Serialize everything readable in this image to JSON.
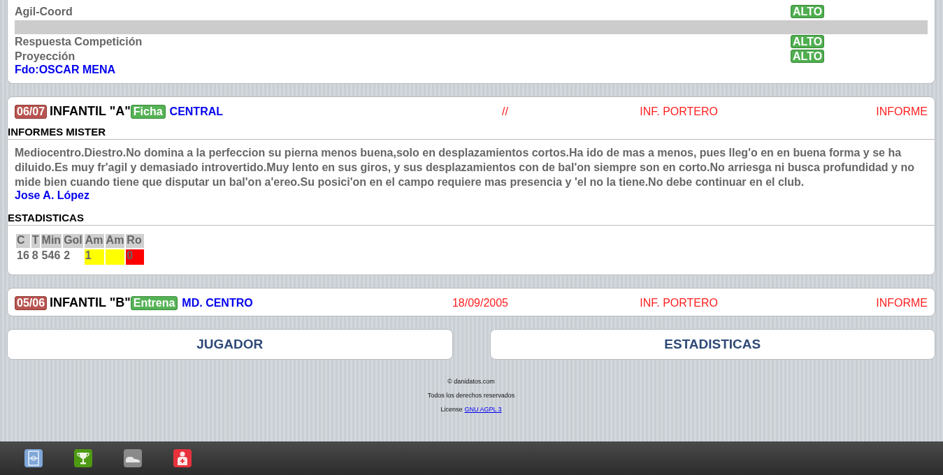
{
  "evaluation": {
    "rows": [
      {
        "kind": "rating",
        "label": "Agil-Coord",
        "value": "ALTO"
      },
      {
        "kind": "separator"
      },
      {
        "kind": "rating",
        "label": "Respuesta Competición",
        "value": "ALTO"
      },
      {
        "kind": "rating",
        "label": "Proyección",
        "value": "ALTO"
      }
    ],
    "signature": "Fdo:OSCAR MENA"
  },
  "seasons": [
    {
      "season": "06/07",
      "team": "INFANTIL \"A\"",
      "tag": "Ficha",
      "position": "CENTRAL",
      "date": "//",
      "portero": "INF. PORTERO",
      "informe": "INFORME",
      "report": {
        "heading": "INFORMES MISTER",
        "text": "Mediocentro.Diestro.No domina a la perfeccion su pierna menos buena,solo en desplazamientos cortos.Ha ido de mas a menos, pues lleg'o en en buena forma y se ha diluido.Es muy fr'agil y demasiado introvertido.Muy lento en sus giros, y sus desplazamientos con de bal'on siempre son en corto.No arriesga ni busca profundidad y no mide bien cuando tiene que disputar un bal'on a'ereo.Su posici'on en el campo requiere mas presencia y 'el no la tiene.No debe continuar en el club.",
        "author": "Jose A. López"
      },
      "stats": {
        "heading": "ESTADISTICAS",
        "columns": [
          {
            "header": "C",
            "value": "16"
          },
          {
            "header": "T",
            "value": "8"
          },
          {
            "header": "Min",
            "value": "546"
          },
          {
            "header": "Gol",
            "value": "2"
          },
          {
            "header": "Am",
            "value": "1",
            "color": "#ffff00"
          },
          {
            "header": "Am",
            "color": "#ffff00"
          },
          {
            "header": "Ro",
            "value": "0",
            "color": "#ff0000"
          }
        ]
      }
    },
    {
      "season": "05/06",
      "team": "INFANTIL \"B\"",
      "tag": "Entrena",
      "position": "MD. CENTRO",
      "date": "18/09/2005",
      "portero": "INF. PORTERO",
      "informe": "INFORME"
    }
  ],
  "buttons": [
    "JUGADOR",
    "ESTADISTICAS"
  ],
  "footer": {
    "copyright": "© danidatos.com",
    "rights": "Todos los derechos reservados",
    "license_label": "License",
    "license_link": "GNU AGPL 3"
  }
}
